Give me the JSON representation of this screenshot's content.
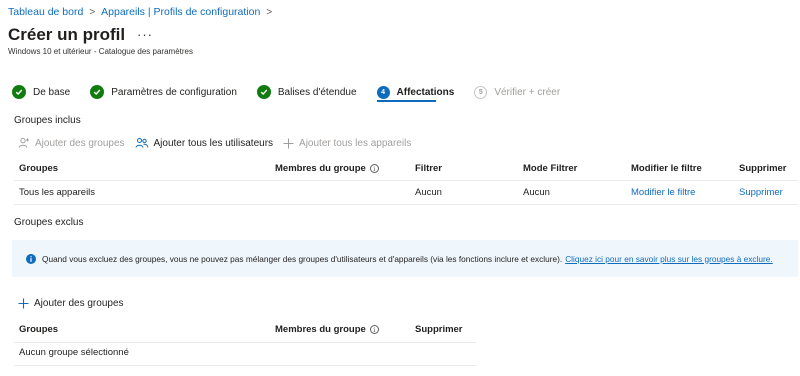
{
  "breadcrumb": {
    "items": [
      "Tableau de bord",
      "Appareils | Profils de configuration"
    ],
    "separator": ">"
  },
  "header": {
    "title": "Créer un profil",
    "more": "···",
    "subtitle": "Windows 10 et ultérieur - Catalogue des paramètres"
  },
  "steps": [
    {
      "label": "De base",
      "state": "done"
    },
    {
      "label": "Paramètres de configuration",
      "state": "done"
    },
    {
      "label": "Balises d'étendue",
      "state": "done"
    },
    {
      "label": "Affectations",
      "state": "active",
      "number": "4"
    },
    {
      "label": "Vérifier + créer",
      "state": "pending",
      "number": "5"
    }
  ],
  "included": {
    "title": "Groupes inclus",
    "toolbar": {
      "add_groups": "Ajouter des groupes",
      "add_all_users": "Ajouter tous les utilisateurs",
      "add_all_devices": "Ajouter tous les appareils"
    },
    "columns": [
      "Groupes",
      "Membres du groupe",
      "Filtrer",
      "Mode Filtrer",
      "Modifier le filtre",
      "Supprimer"
    ],
    "rows": [
      {
        "group": "Tous les appareils",
        "members": "",
        "filter": "Aucun",
        "filter_mode": "Aucun",
        "edit_filter": "Modifier le filtre",
        "delete": "Supprimer"
      }
    ]
  },
  "excluded": {
    "title": "Groupes exclus",
    "info_text": "Quand vous excluez des groupes, vous ne pouvez pas mélanger des groupes d'utilisateurs et d'appareils (via les fonctions inclure et exclure).",
    "info_link": "Cliquez ici pour en savoir plus sur les groupes à exclure.",
    "add_groups": "Ajouter des groupes",
    "columns": [
      "Groupes",
      "Membres du groupe",
      "Supprimer"
    ],
    "empty": "Aucun groupe sélectionné"
  },
  "colors": {
    "accent": "#0f6cbd",
    "success": "#107c10",
    "info_bg": "#eff6fc"
  }
}
